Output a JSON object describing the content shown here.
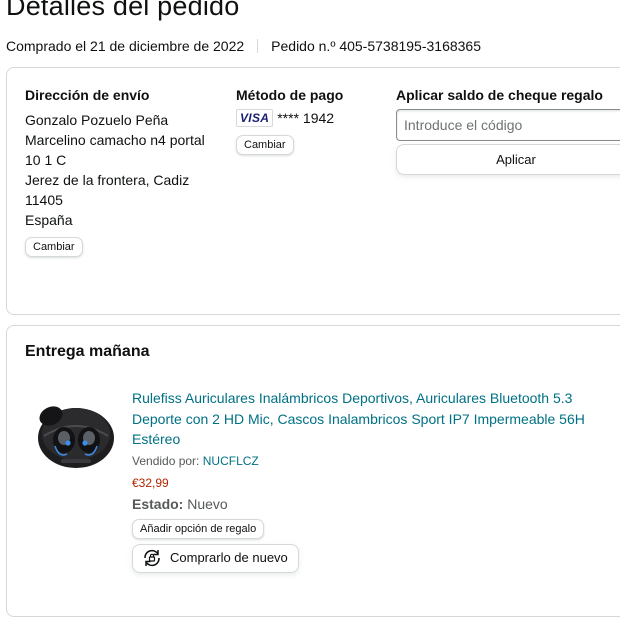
{
  "header": {
    "title": "Detalles del pedido",
    "order_date": "Comprado el 21 de diciembre de 2022",
    "order_number": "Pedido n.º 405-5738195-3168365"
  },
  "shipping": {
    "heading": "Dirección de envío",
    "lines": [
      "Gonzalo Pozuelo Peña",
      "Marcelino camacho n4 portal",
      "10 1 C",
      "Jerez de la frontera, Cadiz",
      "11405",
      "España"
    ],
    "change_label": "Cambiar"
  },
  "payment": {
    "heading": "Método de pago",
    "card_brand": "VISA",
    "card_number": "**** 1942",
    "change_label": "Cambiar"
  },
  "gift_card": {
    "heading": "Aplicar saldo de cheque regalo",
    "placeholder": "Introduce el código",
    "value": "",
    "apply_label": "Aplicar"
  },
  "delivery": {
    "heading": "Entrega mañana",
    "product": {
      "title": "Rulefiss Auriculares Inalámbricos Deportivos, Auriculares Bluetooth 5.3 Deporte con 2 HD Mic, Cascos Inalambricos Sport IP7 Impermeable 56H Estéreo",
      "seller_label": "Vendido por:",
      "seller_name": "NUCFLCZ",
      "price": "€32,99",
      "status_label": "Estado:",
      "status_value": "Nuevo",
      "gift_option_label": "Añadir opción de regalo",
      "buy_again_label": "Comprarlo de nuevo",
      "image_icon": "wireless-earbuds-image"
    }
  },
  "colors": {
    "link": "#007185",
    "price": "#b12704",
    "border": "#d5d9d9",
    "text": "#0f1111"
  }
}
